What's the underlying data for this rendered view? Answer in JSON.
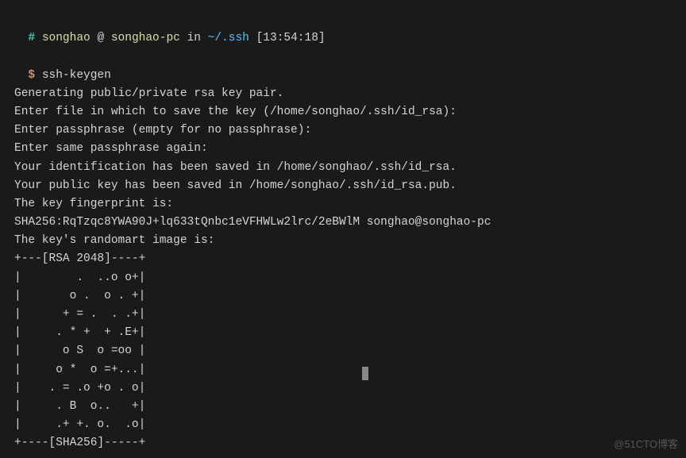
{
  "prompt": {
    "hash": "#",
    "user": "songhao",
    "at": "@",
    "host": "songhao-pc",
    "in": "in",
    "path": "~/.ssh",
    "time": "[13:54:18]",
    "dollar": "$",
    "command": "ssh-keygen"
  },
  "output": {
    "lines": [
      "Generating public/private rsa key pair.",
      "Enter file in which to save the key (/home/songhao/.ssh/id_rsa):",
      "Enter passphrase (empty for no passphrase):",
      "Enter same passphrase again:",
      "Your identification has been saved in /home/songhao/.ssh/id_rsa.",
      "Your public key has been saved in /home/songhao/.ssh/id_rsa.pub.",
      "The key fingerprint is:",
      "SHA256:RqTzqc8YWA90J+lq633tQnbc1eVFHWLw2lrc/2eBWlM songhao@songhao-pc",
      "The key's randomart image is:",
      "+---[RSA 2048]----+",
      "|        .  ..o o+|",
      "|       o .  o . +|",
      "|      + = .  . .+|",
      "|     . * +  + .E+|",
      "|      o S  o =oo |",
      "|     o *  o =+...|",
      "|    . = .o +o . o|",
      "|     . B  o..   +|",
      "|     .+ +. o.  .o|",
      "+----[SHA256]-----+"
    ]
  },
  "watermark": "@51CTO博客"
}
